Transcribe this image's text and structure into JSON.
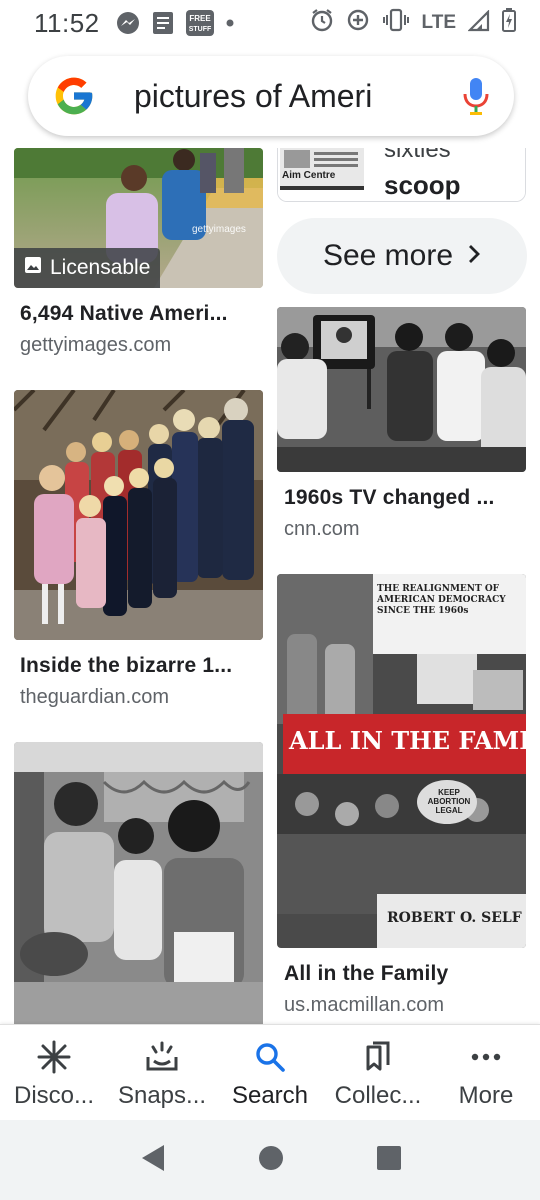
{
  "status_bar": {
    "time": "11:52",
    "network": "LTE",
    "icons": [
      "messenger-icon",
      "news-icon",
      "free-stuff-icon",
      "dot-icon",
      "alarm-icon",
      "data-saver-icon",
      "vibrate-icon",
      "signal-icon",
      "battery-icon"
    ],
    "free_stuff_label": "FREE STUFF"
  },
  "search": {
    "query": "pictures of Ameri",
    "logo": "google-g-icon",
    "mic": "mic-icon"
  },
  "results": {
    "left": [
      {
        "title": "6,494 Native Ameri...",
        "source": "gettyimages.com",
        "badge": "Licensable",
        "watermark": "gettyimages"
      },
      {
        "title": "Inside the bizarre 1...",
        "source": "theguardian.com"
      },
      {
        "title": "",
        "source": ""
      }
    ],
    "right": [
      {
        "snippet_top": "sixties",
        "snippet_bottom": "scoop",
        "caption": "Aim Centre"
      },
      {
        "title": "1960s TV changed ...",
        "source": "cnn.com"
      },
      {
        "title": "All in the Family",
        "source": "us.macmillan.com",
        "book": {
          "subtitle": "THE REALIGNMENT OF AMERICAN DEMOCRACY SINCE THE 1960s",
          "title": "ALL IN THE FAMILY",
          "author": "ROBERT O. SELF",
          "sign": "KEEP ABORTION LEGAL"
        }
      }
    ],
    "see_more": "See more"
  },
  "bottom_nav": [
    {
      "label": "Disco...",
      "icon": "asterisk-icon"
    },
    {
      "label": "Snaps...",
      "icon": "snapshot-icon"
    },
    {
      "label": "Search",
      "icon": "search-icon"
    },
    {
      "label": "Collec...",
      "icon": "collections-icon"
    },
    {
      "label": "More",
      "icon": "more-dots-icon"
    }
  ],
  "colors": {
    "accent": "#1a73e8",
    "text": "#202124",
    "secondary": "#5f6368",
    "chip": "#f1f3f4",
    "book_red": "#c8262a"
  }
}
